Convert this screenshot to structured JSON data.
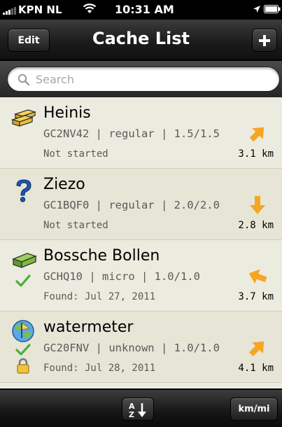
{
  "status_bar": {
    "carrier": "KPN NL",
    "time": "10:31 AM"
  },
  "nav": {
    "title": "Cache List",
    "edit_label": "Edit",
    "add_label": "+"
  },
  "search": {
    "placeholder": "Search",
    "value": ""
  },
  "caches": [
    {
      "name": "Heinis",
      "code": "GC2NV42",
      "size": "regular",
      "rating": "1.5/1.5",
      "details": "GC2NV42 | regular | 1.5/1.5",
      "status": "Not started",
      "distance": "3.1 km",
      "type_icon": "multi-cache-icon",
      "direction_icon": "arrow-down-left-icon",
      "found": false,
      "locked": false
    },
    {
      "name": "Ziezo",
      "code": "GC1BQF0",
      "size": "regular",
      "rating": "2.0/2.0",
      "details": "GC1BQF0 | regular | 2.0/2.0",
      "status": "Not started",
      "distance": "2.8 km",
      "type_icon": "mystery-cache-icon",
      "direction_icon": "arrow-down-icon",
      "found": false,
      "locked": false
    },
    {
      "name": "Bossche Bollen",
      "code": "GCHQ10",
      "size": "micro",
      "rating": "1.0/1.0",
      "details": "GCHQ10 | micro | 1.0/1.0",
      "status": "Found: Jul 27, 2011",
      "distance": "3.7 km",
      "type_icon": "traditional-cache-icon",
      "direction_icon": "arrow-left-up-icon",
      "found": true,
      "locked": false
    },
    {
      "name": "watermeter",
      "code": "GC20FNV",
      "size": "unknown",
      "rating": "1.0/1.0",
      "details": "GC20FNV | unknown | 1.0/1.0",
      "status": "Found: Jul 28, 2011",
      "distance": "4.1 km",
      "type_icon": "earth-cache-icon",
      "direction_icon": "arrow-down-left-icon",
      "found": true,
      "locked": true
    }
  ],
  "toolbar": {
    "sort_icon": "sort-az-icon",
    "unit_label": "km/mi"
  },
  "colors": {
    "row_background": "#ecebdf",
    "arrow": "#f5a623",
    "found_check": "#4caf3a",
    "bar_dark": "#1c1c1c"
  }
}
